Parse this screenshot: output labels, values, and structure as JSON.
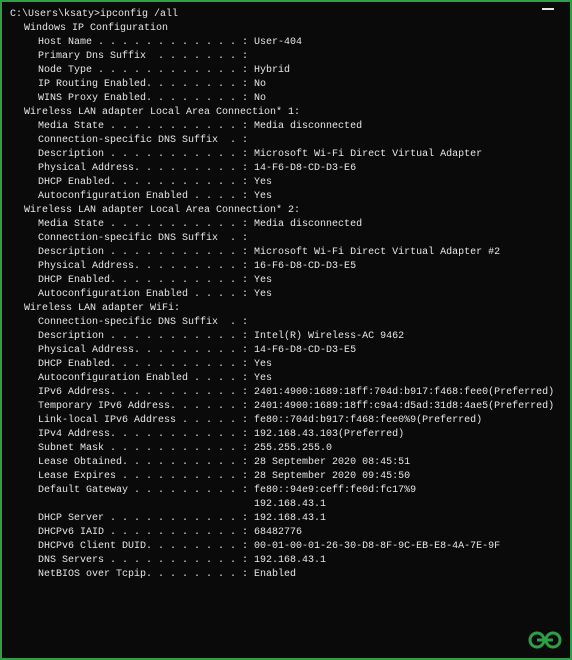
{
  "prompt": "C:\\Users\\ksaty>",
  "command": "ipconfig /all",
  "header": "Windows IP Configuration",
  "host_info": [
    {
      "label": "Host Name . . . . . . . . . . . . :",
      "value": "User-404"
    },
    {
      "label": "Primary Dns Suffix  . . . . . . . :",
      "value": ""
    },
    {
      "label": "Node Type . . . . . . . . . . . . :",
      "value": "Hybrid"
    },
    {
      "label": "IP Routing Enabled. . . . . . . . :",
      "value": "No"
    },
    {
      "label": "WINS Proxy Enabled. . . . . . . . :",
      "value": "No"
    }
  ],
  "adapters": [
    {
      "title": "Wireless LAN adapter Local Area Connection* 1:",
      "rows": [
        {
          "label": "Media State . . . . . . . . . . . :",
          "value": "Media disconnected"
        },
        {
          "label": "Connection-specific DNS Suffix  . :",
          "value": ""
        },
        {
          "label": "Description . . . . . . . . . . . :",
          "value": "Microsoft Wi-Fi Direct Virtual Adapter"
        },
        {
          "label": "Physical Address. . . . . . . . . :",
          "value": "14-F6-D8-CD-D3-E6"
        },
        {
          "label": "DHCP Enabled. . . . . . . . . . . :",
          "value": "Yes"
        },
        {
          "label": "Autoconfiguration Enabled . . . . :",
          "value": "Yes"
        }
      ]
    },
    {
      "title": "Wireless LAN adapter Local Area Connection* 2:",
      "rows": [
        {
          "label": "Media State . . . . . . . . . . . :",
          "value": "Media disconnected"
        },
        {
          "label": "Connection-specific DNS Suffix  . :",
          "value": ""
        },
        {
          "label": "Description . . . . . . . . . . . :",
          "value": "Microsoft Wi-Fi Direct Virtual Adapter #2"
        },
        {
          "label": "Physical Address. . . . . . . . . :",
          "value": "16-F6-D8-CD-D3-E5"
        },
        {
          "label": "DHCP Enabled. . . . . . . . . . . :",
          "value": "Yes"
        },
        {
          "label": "Autoconfiguration Enabled . . . . :",
          "value": "Yes"
        }
      ]
    },
    {
      "title": "Wireless LAN adapter WiFi:",
      "rows": [
        {
          "label": "Connection-specific DNS Suffix  . :",
          "value": ""
        },
        {
          "label": "Description . . . . . . . . . . . :",
          "value": "Intel(R) Wireless-AC 9462"
        },
        {
          "label": "Physical Address. . . . . . . . . :",
          "value": "14-F6-D8-CD-D3-E5"
        },
        {
          "label": "DHCP Enabled. . . . . . . . . . . :",
          "value": "Yes"
        },
        {
          "label": "Autoconfiguration Enabled . . . . :",
          "value": "Yes"
        },
        {
          "label": "IPv6 Address. . . . . . . . . . . :",
          "value": "2401:4900:1689:18ff:704d:b917:f468:fee0(Preferred)"
        },
        {
          "label": "Temporary IPv6 Address. . . . . . :",
          "value": "2401:4900:1689:18ff:c9a4:d5ad:31d8:4ae5(Preferred)"
        },
        {
          "label": "Link-local IPv6 Address . . . . . :",
          "value": "fe80::704d:b917:f468:fee0%9(Preferred)"
        },
        {
          "label": "IPv4 Address. . . . . . . . . . . :",
          "value": "192.168.43.103(Preferred)"
        },
        {
          "label": "Subnet Mask . . . . . . . . . . . :",
          "value": "255.255.255.0"
        },
        {
          "label": "Lease Obtained. . . . . . . . . . :",
          "value": "28 September 2020 08:45:51"
        },
        {
          "label": "Lease Expires . . . . . . . . . . :",
          "value": "28 September 2020 09:45:50"
        },
        {
          "label": "Default Gateway . . . . . . . . . :",
          "value": "fe80::94e9:ceff:fe0d:fc17%9"
        },
        {
          "label": "                                   ",
          "value": "192.168.43.1"
        },
        {
          "label": "DHCP Server . . . . . . . . . . . :",
          "value": "192.168.43.1"
        },
        {
          "label": "DHCPv6 IAID . . . . . . . . . . . :",
          "value": "68482776"
        },
        {
          "label": "DHCPv6 Client DUID. . . . . . . . :",
          "value": "00-01-00-01-26-30-D8-8F-9C-EB-E8-4A-7E-9F"
        },
        {
          "label": "DNS Servers . . . . . . . . . . . :",
          "value": "192.168.43.1"
        },
        {
          "label": "NetBIOS over Tcpip. . . . . . . . :",
          "value": "Enabled"
        }
      ]
    }
  ]
}
